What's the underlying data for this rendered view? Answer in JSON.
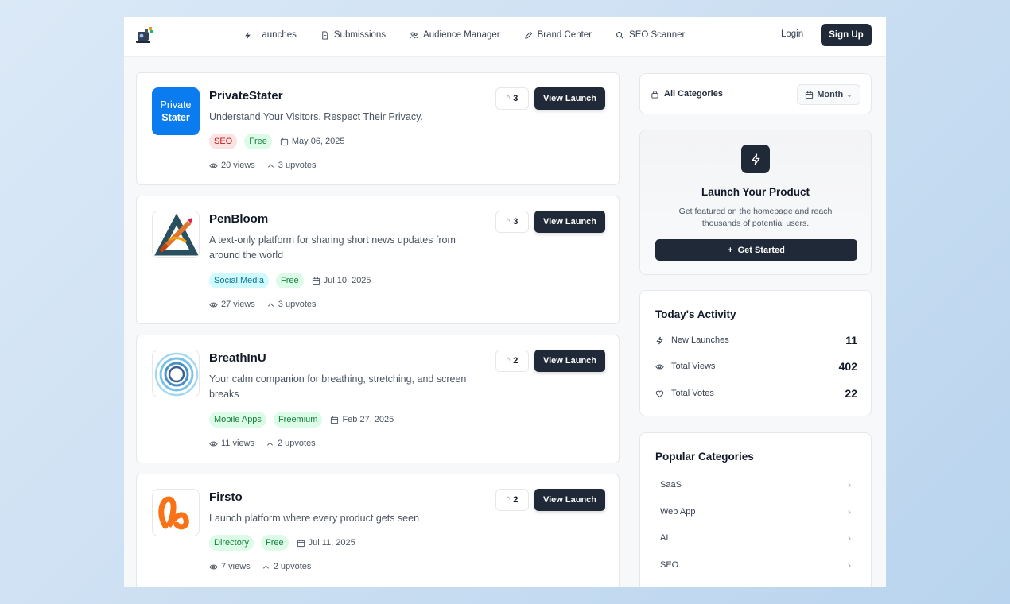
{
  "header": {
    "nav": [
      {
        "label": "Launches",
        "icon": "bolt-icon"
      },
      {
        "label": "Submissions",
        "icon": "document-icon"
      },
      {
        "label": "Audience Manager",
        "icon": "users-icon"
      },
      {
        "label": "Brand Center",
        "icon": "pencil-icon"
      },
      {
        "label": "SEO Scanner",
        "icon": "search-icon"
      }
    ],
    "login_label": "Login",
    "signup_label": "Sign Up"
  },
  "launches": [
    {
      "name": "PrivateStater",
      "logo_text_1": "Private",
      "logo_text_2": "Stater",
      "description": "Understand Your Visitors. Respect Their Privacy.",
      "tags": [
        {
          "label": "SEO",
          "bg": "#fde2e2",
          "fg": "#b91c1c"
        },
        {
          "label": "Free",
          "bg": "#dcfce7",
          "fg": "#15803d"
        }
      ],
      "date": "May 06, 2025",
      "views": "20 views",
      "upvotes": "3 upvotes",
      "votes": "3",
      "view_label": "View Launch"
    },
    {
      "name": "PenBloom",
      "description": "A text-only platform for sharing short news updates from around the world",
      "tags": [
        {
          "label": "Social Media",
          "bg": "#cffafe",
          "fg": "#0e7490"
        },
        {
          "label": "Free",
          "bg": "#dcfce7",
          "fg": "#15803d"
        }
      ],
      "date": "Jul 10, 2025",
      "views": "27 views",
      "upvotes": "3 upvotes",
      "votes": "3",
      "view_label": "View Launch"
    },
    {
      "name": "BreathInU",
      "description": "Your calm companion for breathing, stretching, and screen breaks",
      "tags": [
        {
          "label": "Mobile Apps",
          "bg": "#dcfce7",
          "fg": "#15803d"
        },
        {
          "label": "Freemium",
          "bg": "#dcfce7",
          "fg": "#15803d"
        }
      ],
      "date": "Feb 27, 2025",
      "views": "11 views",
      "upvotes": "2 upvotes",
      "votes": "2",
      "view_label": "View Launch"
    },
    {
      "name": "Firsto",
      "description": "Launch platform where every product gets seen",
      "tags": [
        {
          "label": "Directory",
          "bg": "#dcfce7",
          "fg": "#15803d"
        },
        {
          "label": "Free",
          "bg": "#dcfce7",
          "fg": "#15803d"
        }
      ],
      "date": "Jul 11, 2025",
      "views": "7 views",
      "upvotes": "2 upvotes",
      "votes": "2",
      "view_label": "View Launch"
    }
  ],
  "filters": {
    "category_label": "All Categories",
    "period_label": "Month"
  },
  "promo": {
    "title": "Launch Your Product",
    "subtitle": "Get featured on the homepage and reach thousands of potential users.",
    "button_label": "Get Started"
  },
  "activity": {
    "title": "Today's Activity",
    "items": [
      {
        "label": "New Launches",
        "value": "11"
      },
      {
        "label": "Total Views",
        "value": "402"
      },
      {
        "label": "Total Votes",
        "value": "22"
      }
    ]
  },
  "popular": {
    "title": "Popular Categories",
    "items": [
      {
        "label": "SaaS"
      },
      {
        "label": "Web App"
      },
      {
        "label": "AI"
      },
      {
        "label": "SEO"
      }
    ]
  }
}
